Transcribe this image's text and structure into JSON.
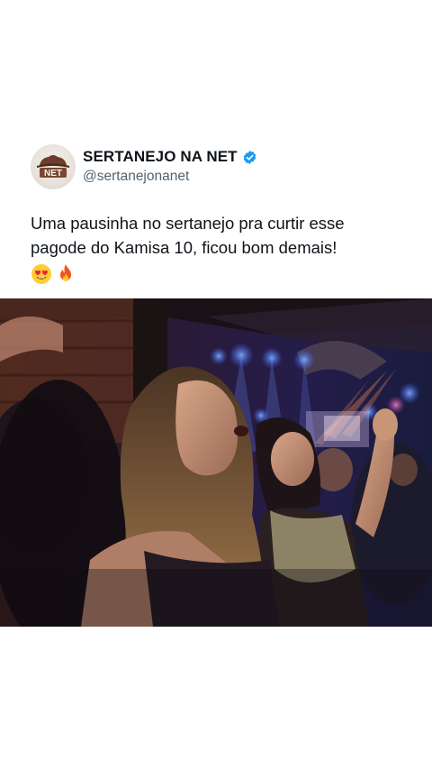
{
  "post": {
    "display_name": "SERTANEJO NA NET",
    "handle": "@sertanejonanet",
    "verified": true,
    "avatar_text": "NET",
    "text_line_1": "Uma pausinha no sertanejo pra curtir esse",
    "text_line_2": "pagode do Kamisa 10, ficou bom demais!",
    "emojis": [
      "heart-eyes-emoji",
      "fire-emoji"
    ]
  },
  "media": {
    "type": "video",
    "description_icon": "concert-crowd-video"
  },
  "colors": {
    "verified_blue": "#1d9bf0",
    "handle_gray": "#536471",
    "text_dark": "#0f1419"
  }
}
